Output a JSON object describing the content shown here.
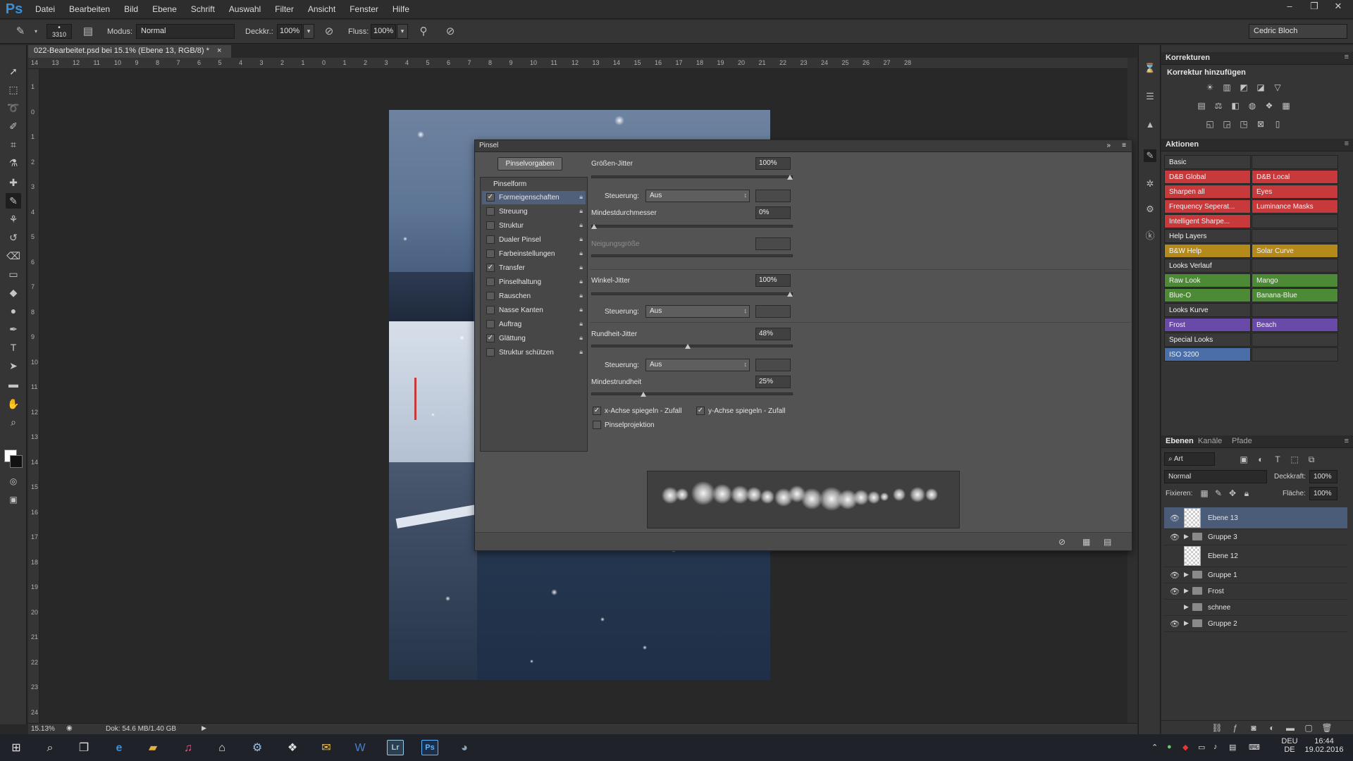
{
  "app": {
    "logo": "Ps",
    "menu": [
      "Datei",
      "Bearbeiten",
      "Bild",
      "Ebene",
      "Schrift",
      "Auswahl",
      "Filter",
      "Ansicht",
      "Fenster",
      "Hilfe"
    ],
    "window_controls": {
      "minimize": "–",
      "restore": "❐",
      "close": "✕"
    }
  },
  "options": {
    "brush_size": "3310",
    "mode_label": "Modus:",
    "mode_value": "Normal",
    "opacity_label": "Deckkr.:",
    "opacity_value": "100%",
    "flow_label": "Fluss:",
    "flow_value": "100%",
    "workspace": "Cedric Bloch"
  },
  "document": {
    "tab_title": "022-Bearbeitet.psd bei 15.1% (Ebene 13, RGB/8) *",
    "tab_close": "×",
    "zoom": "15.13%",
    "doc_info": "Dok: 54.6 MB/1.40 GB",
    "ruler_top": [
      "14",
      "13",
      "12",
      "11",
      "10",
      "9",
      "8",
      "7",
      "6",
      "5",
      "4",
      "3",
      "2",
      "1",
      "0",
      "1",
      "2",
      "3",
      "4",
      "5",
      "6",
      "7",
      "8",
      "9",
      "10",
      "11",
      "12",
      "13",
      "14",
      "15",
      "16",
      "17",
      "18",
      "19",
      "20",
      "21",
      "22",
      "23",
      "24",
      "25",
      "26",
      "27",
      "28"
    ],
    "ruler_left": [
      "1",
      "0",
      "1",
      "2",
      "3",
      "4",
      "5",
      "6",
      "7",
      "8",
      "9",
      "10",
      "11",
      "12",
      "13",
      "14",
      "15",
      "16",
      "17",
      "18",
      "19",
      "20",
      "21",
      "22",
      "23",
      "24",
      "25"
    ]
  },
  "brush_panel": {
    "title": "Pinsel",
    "presets_button": "Pinselvorgaben",
    "list_header": "Pinselform",
    "items": [
      {
        "label": "Formeigenschaften",
        "checked": true,
        "selected": true
      },
      {
        "label": "Streuung",
        "checked": false
      },
      {
        "label": "Struktur",
        "checked": false
      },
      {
        "label": "Dualer Pinsel",
        "checked": false
      },
      {
        "label": "Farbeinstellungen",
        "checked": false
      },
      {
        "label": "Transfer",
        "checked": true
      },
      {
        "label": "Pinselhaltung",
        "checked": false
      },
      {
        "label": "Rauschen",
        "checked": false
      },
      {
        "label": "Nasse Kanten",
        "checked": false
      },
      {
        "label": "Auftrag",
        "checked": false
      },
      {
        "label": "Glättung",
        "checked": true
      },
      {
        "label": "Struktur schützen",
        "checked": false
      }
    ],
    "size_jitter": {
      "label": "Größen-Jitter",
      "value": "100%",
      "level": 1.0
    },
    "control_label": "Steuerung:",
    "control_value": "Aus",
    "min_diameter": {
      "label": "Mindestdurchmesser",
      "value": "0%",
      "level": 0.0
    },
    "tilt_scale": {
      "label": "Neigungsgröße"
    },
    "angle_jitter": {
      "label": "Winkel-Jitter",
      "value": "100%",
      "level": 1.0
    },
    "roundness_jitter": {
      "label": "Rundheit-Jitter",
      "value": "48%",
      "level": 0.48
    },
    "min_roundness": {
      "label": "Mindestrundheit",
      "value": "25%",
      "level": 0.25
    },
    "flip_x": {
      "label": "x-Achse spiegeln - Zufall",
      "checked": true
    },
    "flip_y": {
      "label": "y-Achse spiegeln - Zufall",
      "checked": true
    },
    "projection": {
      "label": "Pinselprojektion",
      "checked": false
    }
  },
  "adjustments": {
    "title": "Korrekturen",
    "subtitle": "Korrektur hinzufügen"
  },
  "actions": {
    "title": "Aktionen",
    "colors": {
      "gray": "#3a3a3a",
      "red": "#c8393c",
      "yellow": "#b48a1a",
      "green": "#4d8a36",
      "violet": "#6a4aa8",
      "blue": "#4a6ea8"
    },
    "rows": [
      [
        {
          "label": "Basic",
          "color": "gray"
        },
        {
          "label": "",
          "color": "gray"
        }
      ],
      [
        {
          "label": "D&B Global",
          "color": "red"
        },
        {
          "label": "D&B Local",
          "color": "red"
        }
      ],
      [
        {
          "label": "Sharpen all",
          "color": "red"
        },
        {
          "label": "Eyes",
          "color": "red"
        }
      ],
      [
        {
          "label": "Frequency Seperat...",
          "color": "red"
        },
        {
          "label": "Luminance Masks",
          "color": "red"
        }
      ],
      [
        {
          "label": "Intelligent Sharpe...",
          "color": "red"
        },
        {
          "label": "",
          "color": "gray"
        }
      ],
      [
        {
          "label": "Help Layers",
          "color": "gray"
        },
        {
          "label": "",
          "color": "gray"
        }
      ],
      [
        {
          "label": "B&W Help",
          "color": "yellow"
        },
        {
          "label": "Solar Curve",
          "color": "yellow"
        }
      ],
      [
        {
          "label": "Looks Verlauf",
          "color": "gray"
        },
        {
          "label": "",
          "color": "gray"
        }
      ],
      [
        {
          "label": "Raw Look",
          "color": "green"
        },
        {
          "label": "Mango",
          "color": "green"
        }
      ],
      [
        {
          "label": "Blue-O",
          "color": "green"
        },
        {
          "label": "Banana-Blue",
          "color": "green"
        }
      ],
      [
        {
          "label": "Looks Kurve",
          "color": "gray"
        },
        {
          "label": "",
          "color": "gray"
        }
      ],
      [
        {
          "label": "Frost",
          "color": "violet"
        },
        {
          "label": "Beach",
          "color": "violet"
        }
      ],
      [
        {
          "label": "Special Looks",
          "color": "gray"
        },
        {
          "label": "",
          "color": "gray"
        }
      ],
      [
        {
          "label": "ISO 3200",
          "color": "blue"
        },
        {
          "label": "",
          "color": "gray"
        }
      ]
    ]
  },
  "layers_panel": {
    "tabs": [
      "Ebenen",
      "Kanäle",
      "Pfade"
    ],
    "filter": "Art",
    "blend_mode": "Normal",
    "opacity_label": "Deckkraft:",
    "opacity_value": "100%",
    "lock_label": "Fixieren:",
    "fill_label": "Fläche:",
    "fill_value": "100%",
    "layers": [
      {
        "name": "Ebene 13",
        "type": "layer",
        "visible": true,
        "selected": true
      },
      {
        "name": "Gruppe 3",
        "type": "group",
        "visible": true
      },
      {
        "name": "Ebene 12",
        "type": "layer",
        "visible": false
      },
      {
        "name": "Gruppe 1",
        "type": "group",
        "visible": true
      },
      {
        "name": "Frost",
        "type": "group",
        "visible": true
      },
      {
        "name": "schnee",
        "type": "group",
        "visible": false
      },
      {
        "name": "Gruppe 2",
        "type": "group",
        "visible": true
      }
    ]
  },
  "taskbar": {
    "lang": "DEU",
    "lang_sub": "DE",
    "time": "16:44",
    "date": "19.02.2016",
    "apps": [
      {
        "label": "Lr",
        "color": "#2b3f4f",
        "text": "#9ac8e8"
      },
      {
        "label": "Ps",
        "color": "#1b2f4a",
        "text": "#5db4ff"
      }
    ]
  }
}
